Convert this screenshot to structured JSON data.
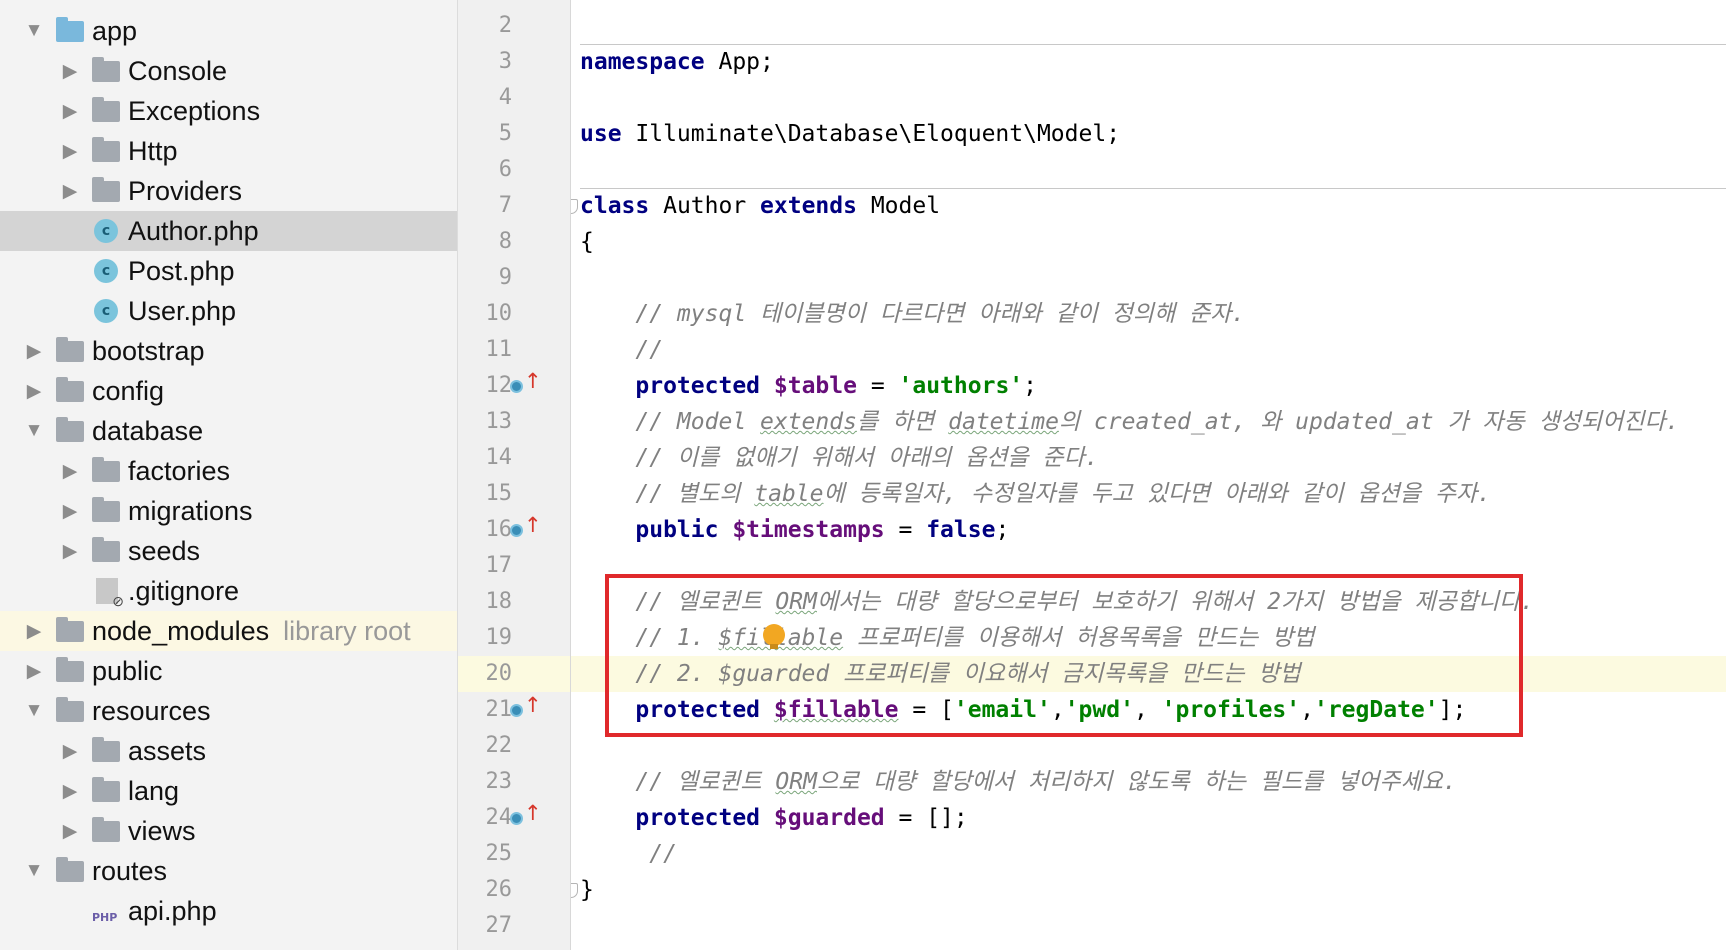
{
  "project_tree": {
    "items": [
      {
        "label": "app",
        "depth": 0,
        "kind": "folder",
        "expanded": true,
        "folder_color": "blue"
      },
      {
        "label": "Console",
        "depth": 1,
        "kind": "folder",
        "expanded": false
      },
      {
        "label": "Exceptions",
        "depth": 1,
        "kind": "folder",
        "expanded": false
      },
      {
        "label": "Http",
        "depth": 1,
        "kind": "folder",
        "expanded": false
      },
      {
        "label": "Providers",
        "depth": 1,
        "kind": "folder",
        "expanded": false
      },
      {
        "label": "Author.php",
        "depth": 1,
        "kind": "class",
        "selected": true
      },
      {
        "label": "Post.php",
        "depth": 1,
        "kind": "class"
      },
      {
        "label": "User.php",
        "depth": 1,
        "kind": "class"
      },
      {
        "label": "bootstrap",
        "depth": 0,
        "kind": "folder",
        "expanded": false
      },
      {
        "label": "config",
        "depth": 0,
        "kind": "folder",
        "expanded": false
      },
      {
        "label": "database",
        "depth": 0,
        "kind": "folder",
        "expanded": true
      },
      {
        "label": "factories",
        "depth": 1,
        "kind": "folder",
        "expanded": false
      },
      {
        "label": "migrations",
        "depth": 1,
        "kind": "folder",
        "expanded": false
      },
      {
        "label": "seeds",
        "depth": 1,
        "kind": "folder",
        "expanded": false
      },
      {
        "label": ".gitignore",
        "depth": 1,
        "kind": "ignored-file"
      },
      {
        "label": "node_modules",
        "depth": 0,
        "kind": "folder",
        "expanded": false,
        "suffix": "library root",
        "library": true
      },
      {
        "label": "public",
        "depth": 0,
        "kind": "folder",
        "expanded": false
      },
      {
        "label": "resources",
        "depth": 0,
        "kind": "folder",
        "expanded": true
      },
      {
        "label": "assets",
        "depth": 1,
        "kind": "folder",
        "expanded": false
      },
      {
        "label": "lang",
        "depth": 1,
        "kind": "folder",
        "expanded": false
      },
      {
        "label": "views",
        "depth": 1,
        "kind": "folder",
        "expanded": false
      },
      {
        "label": "routes",
        "depth": 0,
        "kind": "folder",
        "expanded": true
      },
      {
        "label": "api.php",
        "depth": 1,
        "kind": "php",
        "icon_text": "PHP"
      }
    ],
    "class_icon_letter": "c"
  },
  "editor": {
    "current_line": 20,
    "lines": [
      {
        "n": "2",
        "tokens": []
      },
      {
        "n": "3",
        "tokens": [
          {
            "c": "kw",
            "t": "namespace"
          },
          {
            "c": "",
            "t": " App;"
          }
        ]
      },
      {
        "n": "4",
        "tokens": []
      },
      {
        "n": "5",
        "tokens": [
          {
            "c": "kw",
            "t": "use"
          },
          {
            "c": "",
            "t": " Illuminate\\Database\\Eloquent\\Model;"
          }
        ]
      },
      {
        "n": "6",
        "tokens": []
      },
      {
        "n": "7",
        "fold": true,
        "tokens": [
          {
            "c": "kw",
            "t": "class"
          },
          {
            "c": "",
            "t": " Author "
          },
          {
            "c": "kw",
            "t": "extends"
          },
          {
            "c": "",
            "t": " Model"
          }
        ]
      },
      {
        "n": "8",
        "tokens": [
          {
            "c": "",
            "t": "{"
          }
        ]
      },
      {
        "n": "9",
        "tokens": []
      },
      {
        "n": "10",
        "tokens": [
          {
            "c": "cmt",
            "t": "    // mysql 테이블명이 다르다면 아래와 같이 정의해 준자."
          }
        ]
      },
      {
        "n": "11",
        "tokens": [
          {
            "c": "cmt",
            "t": "    //"
          }
        ]
      },
      {
        "n": "12",
        "override": true,
        "tokens": [
          {
            "c": "kw",
            "t": "    protected "
          },
          {
            "c": "var",
            "t": "$table"
          },
          {
            "c": "",
            "t": " = "
          },
          {
            "c": "str",
            "t": "'authors'"
          },
          {
            "c": "",
            "t": ";"
          }
        ]
      },
      {
        "n": "13",
        "tokens": [
          {
            "c": "cmt",
            "t": "    // Model "
          },
          {
            "c": "cmt squig",
            "t": "extends"
          },
          {
            "c": "cmt",
            "t": "를 하면 "
          },
          {
            "c": "cmt squig",
            "t": "datetime"
          },
          {
            "c": "cmt",
            "t": "의 created_at, 와 updated_at 가 자동 생성되어진다."
          }
        ]
      },
      {
        "n": "14",
        "tokens": [
          {
            "c": "cmt",
            "t": "    // 이를 없애기 위해서 아래의 옵션을 준다."
          }
        ]
      },
      {
        "n": "15",
        "tokens": [
          {
            "c": "cmt",
            "t": "    // 별도의 "
          },
          {
            "c": "cmt squig",
            "t": "table"
          },
          {
            "c": "cmt",
            "t": "에 등록일자, 수정일자를 두고 있다면 아래와 같이 옵션을 주자."
          }
        ]
      },
      {
        "n": "16",
        "override": true,
        "tokens": [
          {
            "c": "kw",
            "t": "    public "
          },
          {
            "c": "var",
            "t": "$timestamps"
          },
          {
            "c": "",
            "t": " = "
          },
          {
            "c": "kw",
            "t": "false"
          },
          {
            "c": "",
            "t": ";"
          }
        ]
      },
      {
        "n": "17",
        "tokens": []
      },
      {
        "n": "18",
        "tokens": [
          {
            "c": "cmt",
            "t": "    // 엘로퀸트 "
          },
          {
            "c": "cmt squig",
            "t": "ORM"
          },
          {
            "c": "cmt",
            "t": "에서는 대량 할당으로부터 보호하기 위해서 2가지 방법을 제공합니다."
          }
        ]
      },
      {
        "n": "19",
        "tokens": [
          {
            "c": "cmt",
            "t": "    // 1. "
          },
          {
            "c": "cmt squig",
            "t": "$fillable"
          },
          {
            "c": "cmt",
            "t": " 프로퍼티를 이용해서 허용목록을 만드는 방법"
          }
        ]
      },
      {
        "n": "20",
        "tokens": [
          {
            "c": "cmt",
            "t": "    // 2. $guarded 프로퍼티를 이요해서 금지목록을 만드는 방법"
          }
        ]
      },
      {
        "n": "21",
        "override": true,
        "tokens": [
          {
            "c": "kw",
            "t": "    protected "
          },
          {
            "c": "var squig",
            "t": "$fillable"
          },
          {
            "c": "",
            "t": " = ["
          },
          {
            "c": "str",
            "t": "'email'"
          },
          {
            "c": "",
            "t": ","
          },
          {
            "c": "str",
            "t": "'pwd'"
          },
          {
            "c": "",
            "t": ", "
          },
          {
            "c": "str",
            "t": "'profiles'"
          },
          {
            "c": "",
            "t": ","
          },
          {
            "c": "str",
            "t": "'regDate'"
          },
          {
            "c": "",
            "t": "];"
          }
        ]
      },
      {
        "n": "22",
        "tokens": []
      },
      {
        "n": "23",
        "tokens": [
          {
            "c": "cmt",
            "t": "    // 엘로퀸트 "
          },
          {
            "c": "cmt squig",
            "t": "ORM"
          },
          {
            "c": "cmt",
            "t": "으로 대량 할당에서 처리하지 않도록 하는 필드를 넣어주세요."
          }
        ]
      },
      {
        "n": "24",
        "override": true,
        "tokens": [
          {
            "c": "kw",
            "t": "    protected "
          },
          {
            "c": "var",
            "t": "$guarded"
          },
          {
            "c": "",
            "t": " = [];"
          }
        ]
      },
      {
        "n": "25",
        "tokens": [
          {
            "c": "cmt",
            "t": "     //"
          }
        ]
      },
      {
        "n": "26",
        "fold": true,
        "tokens": [
          {
            "c": "",
            "t": "}"
          }
        ]
      },
      {
        "n": "27",
        "tokens": []
      }
    ]
  },
  "colors": {
    "keyword": "#000080",
    "variable": "#660e7a",
    "string": "#008000",
    "comment": "#808080",
    "highlight_box": "#e0292b"
  }
}
